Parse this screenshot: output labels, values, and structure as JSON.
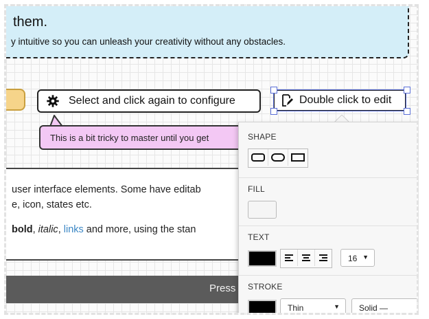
{
  "note": {
    "title": "them.",
    "body": "y intuitive so you can unleash your creativity without any obstacles."
  },
  "canvas": {
    "configure_button_label": "Select and click again to configure",
    "edit_button_label": "Double click to edit",
    "tooltip_text": "This is a bit tricky to master until you get",
    "text_panel": {
      "line1": "user interface elements. Some have editab",
      "line2": "e, icon, states etc.",
      "line3_bold": "bold",
      "line3_sep1": ", ",
      "line3_italic": "italic",
      "line3_sep2": ", ",
      "line3_link": "links",
      "line3_rest": " and more, using the stan"
    },
    "dark_bar_text": "Press"
  },
  "properties_panel": {
    "shape_label": "SHAPE",
    "shape_options": [
      "rounded-rectangle-icon",
      "pill-icon",
      "rectangle-icon"
    ],
    "fill_label": "FILL",
    "text_label": "TEXT",
    "text_color": "#000000",
    "align_options": [
      "align-left-icon",
      "align-center-icon",
      "align-right-icon"
    ],
    "font_size": "16",
    "dropdown_arrow": "▼",
    "stroke_label": "STROKE",
    "stroke_color": "#000000",
    "stroke_width": "Thin",
    "stroke_style": "Solid —"
  },
  "colors": {
    "note_bg": "#d4eef8",
    "yellow_button": "#f6d48a",
    "tooltip_bg": "#f3c8f4",
    "selection_handles": "#5a6fd8",
    "link": "#3a86c4",
    "dark_bar": "#5b5b5b"
  }
}
